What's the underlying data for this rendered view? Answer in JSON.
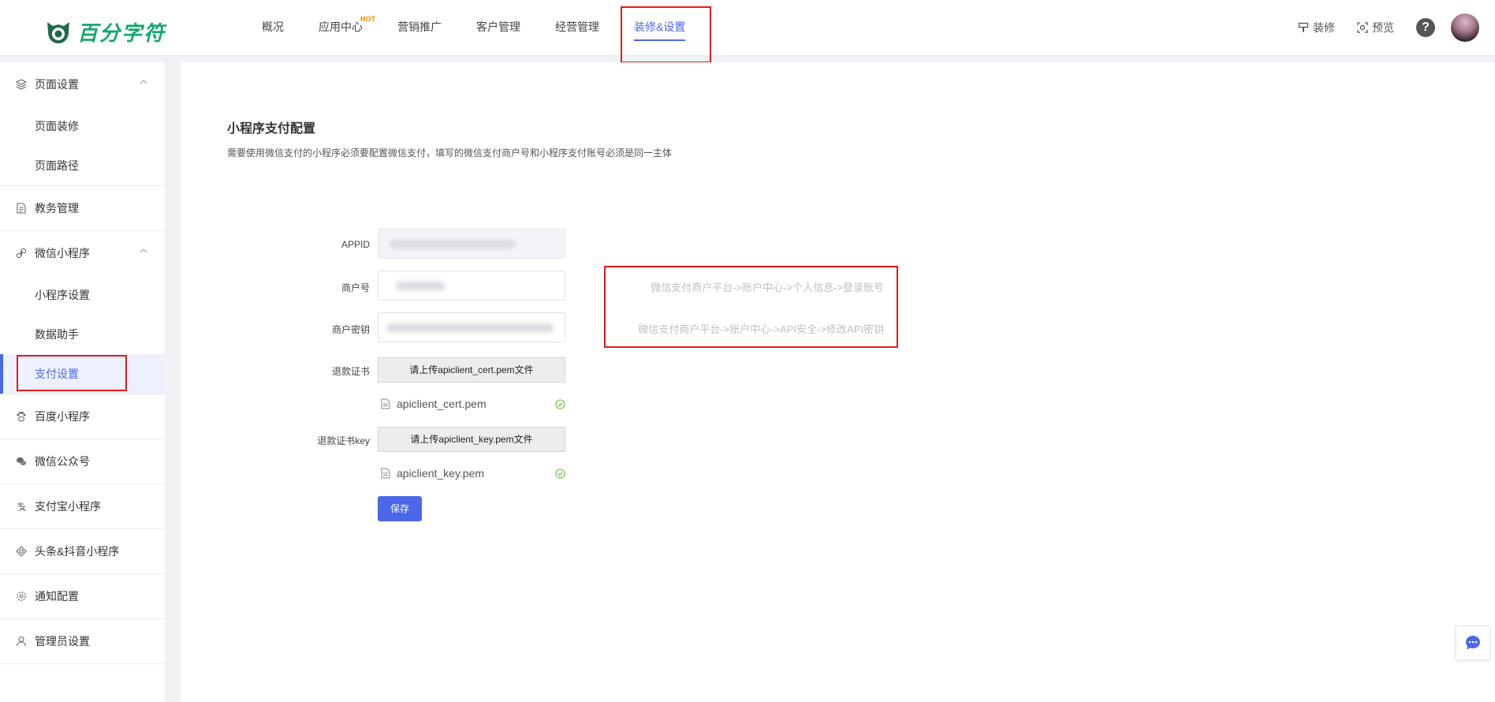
{
  "brand": {
    "name": "百分字符",
    "color": "#14a86b"
  },
  "nav": {
    "items": [
      {
        "label": "概况"
      },
      {
        "label": "应用中心",
        "badge": "HOT"
      },
      {
        "label": "营销推广"
      },
      {
        "label": "客户管理"
      },
      {
        "label": "经营管理"
      },
      {
        "label": "装修&设置",
        "active": true
      }
    ],
    "accent": "#4c68e8"
  },
  "header_right": {
    "decorate_label": "装修",
    "preview_label": "预览",
    "help_label": "?"
  },
  "sidebar": {
    "groups": [
      {
        "label": "页面设置",
        "icon": "layers-icon",
        "expanded": true,
        "children": [
          "页面装修",
          "页面路径"
        ]
      },
      {
        "label": "教务管理",
        "icon": "document-icon"
      },
      {
        "label": "微信小程序",
        "icon": "mini-program-icon",
        "expanded": true,
        "children": [
          "小程序设置",
          "数据助手",
          "支付设置"
        ],
        "active_child": "支付设置"
      },
      {
        "label": "百度小程序",
        "icon": "paw-icon"
      },
      {
        "label": "微信公众号",
        "icon": "wechat-icon"
      },
      {
        "label": "支付宝小程序",
        "icon": "alipay-icon"
      },
      {
        "label": "头条&抖音小程序",
        "icon": "toutiao-icon"
      },
      {
        "label": "通知配置",
        "icon": "gear-icon"
      },
      {
        "label": "管理员设置",
        "icon": "user-icon"
      }
    ]
  },
  "main": {
    "title": "小程序支付配置",
    "description": "需要使用微信支付的小程序必须要配置微信支付，填写的微信支付商户号和小程序支付账号必须是同一主体",
    "form": {
      "appid_label": "APPID",
      "merchant_label": "商户号",
      "secret_label": "商户密钥",
      "cert_label": "退款证书",
      "cert_upload": "请上传apiclient_cert.pem文件",
      "cert_file": "apiclient_cert.pem",
      "key_label": "退款证书key",
      "key_upload": "请上传apiclient_key.pem文件",
      "key_file": "apiclient_key.pem",
      "save": "保存"
    },
    "hints": {
      "merchant": "微信支付商户平台->账户中心->个人信息->登录账号",
      "secret": "微信支付商户平台->账户中心->API安全->修改API密钥"
    }
  },
  "colors": {
    "highlight": "#e01b1b",
    "success": "#67c23a"
  }
}
